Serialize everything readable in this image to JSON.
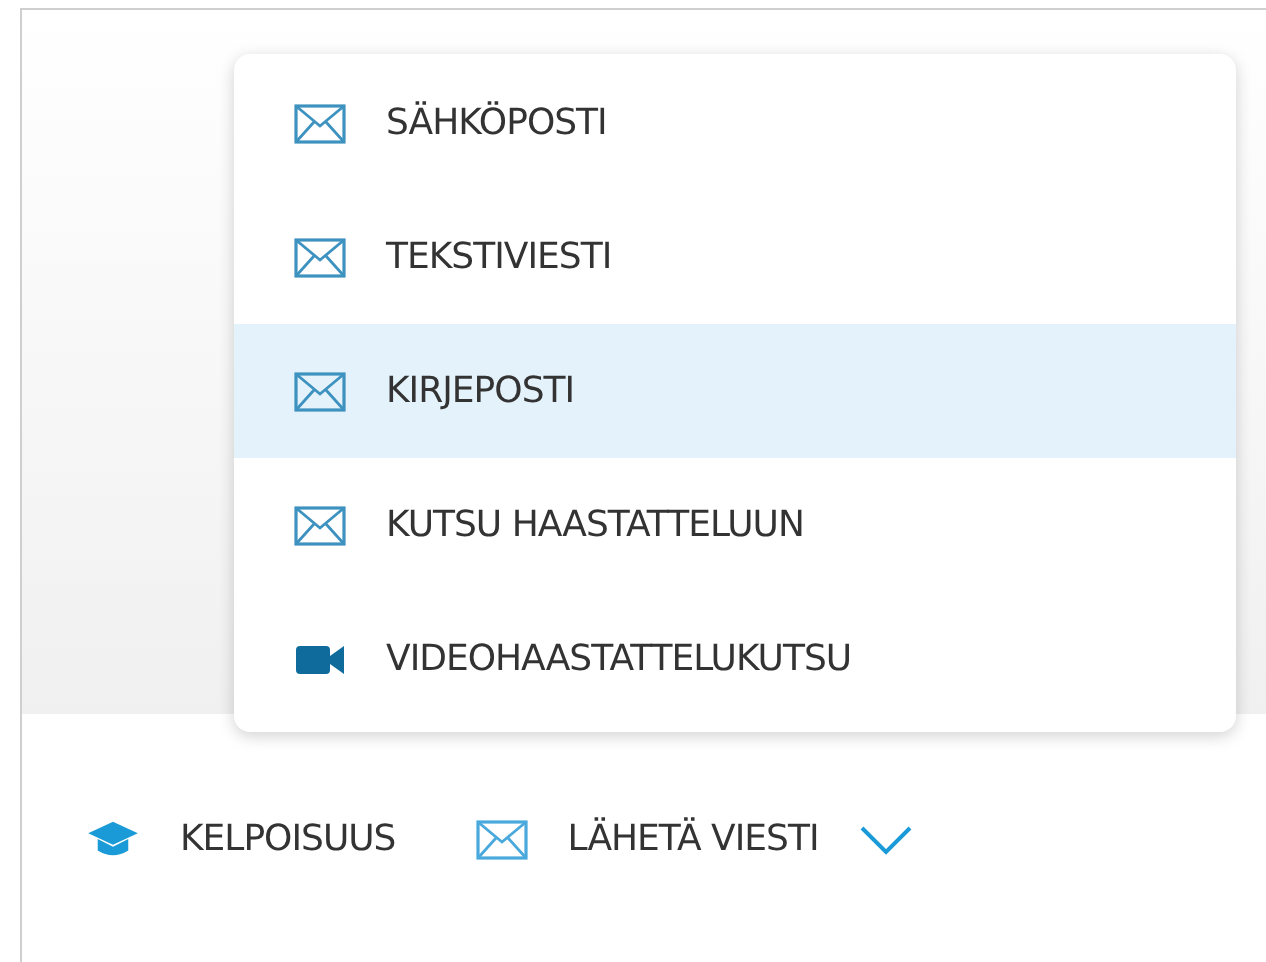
{
  "menu": {
    "items": [
      {
        "label": "SÄHKÖPOSTI",
        "kind": "mail",
        "selected": false
      },
      {
        "label": "TEKSTIVIESTI",
        "kind": "mail",
        "selected": false
      },
      {
        "label": "KIRJEPOSTI",
        "kind": "mail",
        "selected": true
      },
      {
        "label": "KUTSU HAASTATTELUUN",
        "kind": "mail",
        "selected": false
      },
      {
        "label": "VIDEOHAASTATTELUKUTSU",
        "kind": "video",
        "selected": false
      }
    ]
  },
  "actions": [
    {
      "label": "KELPOISUUS",
      "kind": "qualification"
    },
    {
      "label": "LÄHETÄ VIESTI",
      "kind": "message",
      "dropdown": true
    }
  ]
}
